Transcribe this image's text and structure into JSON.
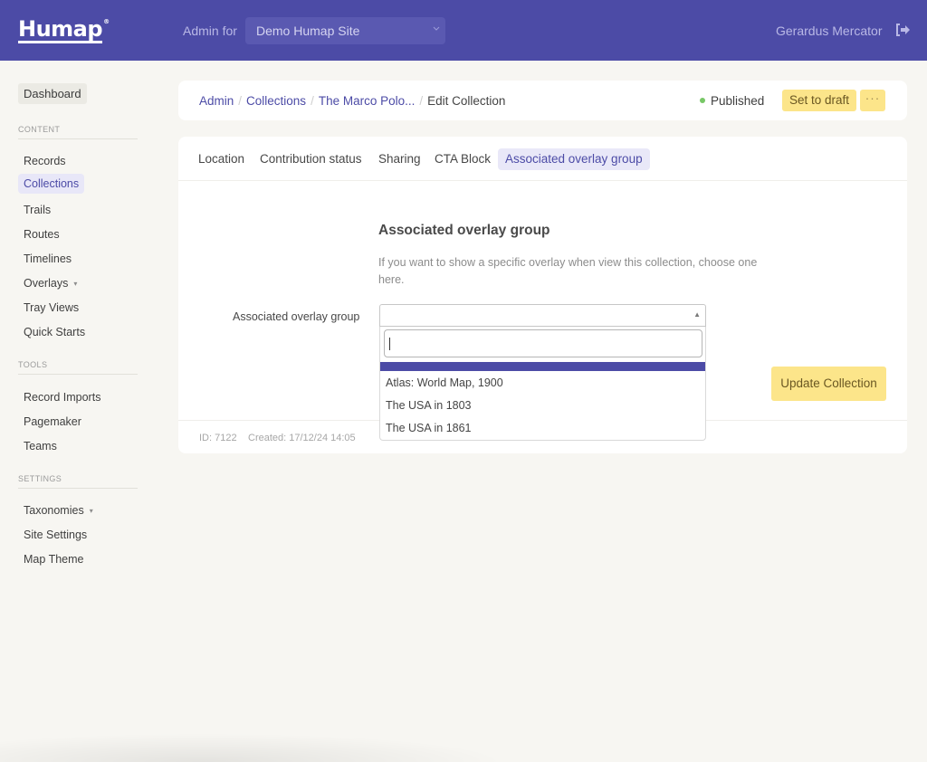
{
  "header": {
    "logo_text": "Humap",
    "logo_mark": "®",
    "admin_for_label": "Admin for",
    "site_select": {
      "value": "Demo Humap Site",
      "icon": "chevron-down-icon"
    },
    "user_name": "Gerardus Mercator",
    "logout_icon": "logout-icon"
  },
  "sidebar": {
    "dashboard_label": "Dashboard",
    "sections": [
      {
        "label": "CONTENT",
        "items": [
          {
            "label": "Records"
          },
          {
            "label": "Collections",
            "active": true
          },
          {
            "label": "Trails"
          },
          {
            "label": "Routes"
          },
          {
            "label": "Timelines"
          },
          {
            "label": "Overlays",
            "caret": "▾"
          },
          {
            "label": "Tray Views"
          },
          {
            "label": "Quick Starts"
          }
        ]
      },
      {
        "label": "TOOLS",
        "items": [
          {
            "label": "Record Imports"
          },
          {
            "label": "Pagemaker"
          },
          {
            "label": "Teams"
          }
        ]
      },
      {
        "label": "SETTINGS",
        "items": [
          {
            "label": "Taxonomies",
            "caret": "▾"
          },
          {
            "label": "Site Settings"
          },
          {
            "label": "Map Theme"
          }
        ]
      }
    ]
  },
  "breadcrumb": {
    "items": [
      "Admin",
      "Collections",
      "The Marco Polo..."
    ],
    "separator": "/",
    "current": "Edit Collection"
  },
  "status": {
    "label": "Published",
    "color": "#77c766"
  },
  "actions": {
    "set_to_draft": "Set to draft",
    "more": "···"
  },
  "tabs": [
    {
      "label": "Location"
    },
    {
      "label": "Contribution status"
    },
    {
      "label": "Sharing"
    },
    {
      "label": "CTA Block"
    },
    {
      "label": "Associated overlay group",
      "active": true
    }
  ],
  "form": {
    "section_title": "Associated overlay group",
    "section_description": "If you want to show a specific overlay when view this collection, choose one here.",
    "field_label": "Associated overlay group",
    "select_value": "",
    "search_value": "",
    "options": [
      {
        "label": "",
        "highlighted": true
      },
      {
        "label": "Atlas: World Map, 1900"
      },
      {
        "label": "The USA in 1803"
      },
      {
        "label": "The USA in 1861"
      }
    ],
    "submit_label": "Update Collection"
  },
  "footer": {
    "id_text": "ID: 7122",
    "created_text": "Created: 17/12/24 14:05"
  },
  "colors": {
    "brand": "#4c4ba6",
    "button_yellow": "#fce58a",
    "background": "#f7f6f2"
  }
}
